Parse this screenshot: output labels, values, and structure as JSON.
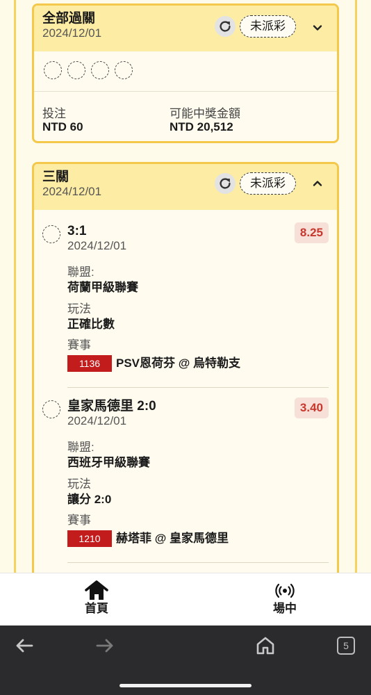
{
  "card1": {
    "title": "全部過關",
    "date": "2024/12/01",
    "status": "未派彩",
    "stake_label": "投注",
    "stake_value": "NTD 60",
    "win_label": "可能中獎金額",
    "win_value": "NTD 20,512"
  },
  "card2": {
    "title": "三關",
    "date": "2024/12/01",
    "status": "未派彩",
    "bets": [
      {
        "title": "3:1",
        "date": "2024/12/01",
        "odds": "8.25",
        "league_label": "聯盟:",
        "league": "荷蘭甲級聯賽",
        "market_label": "玩法",
        "market": "正確比數",
        "event_label": "賽事",
        "event_id": "1136",
        "event_name": "PSV恩荷芬 @ 烏特勒支"
      },
      {
        "title": "皇家馬德里 2:0",
        "date": "2024/12/01",
        "odds": "3.40",
        "league_label": "聯盟:",
        "league": "西班牙甲級聯賽",
        "market_label": "玩法",
        "market": "讓分 2:0",
        "event_label": "賽事",
        "event_id": "1210",
        "event_name": "赫塔菲 @ 皇家馬德里"
      }
    ]
  },
  "nav": {
    "home_label": "首頁",
    "live_label": "場中"
  },
  "browser": {
    "tab_count": "5"
  },
  "colors": {
    "card_border": "#f4c84a",
    "card_header": "#fdeca3",
    "odds_text": "#c8372d",
    "event_badge": "#c21c1c"
  }
}
